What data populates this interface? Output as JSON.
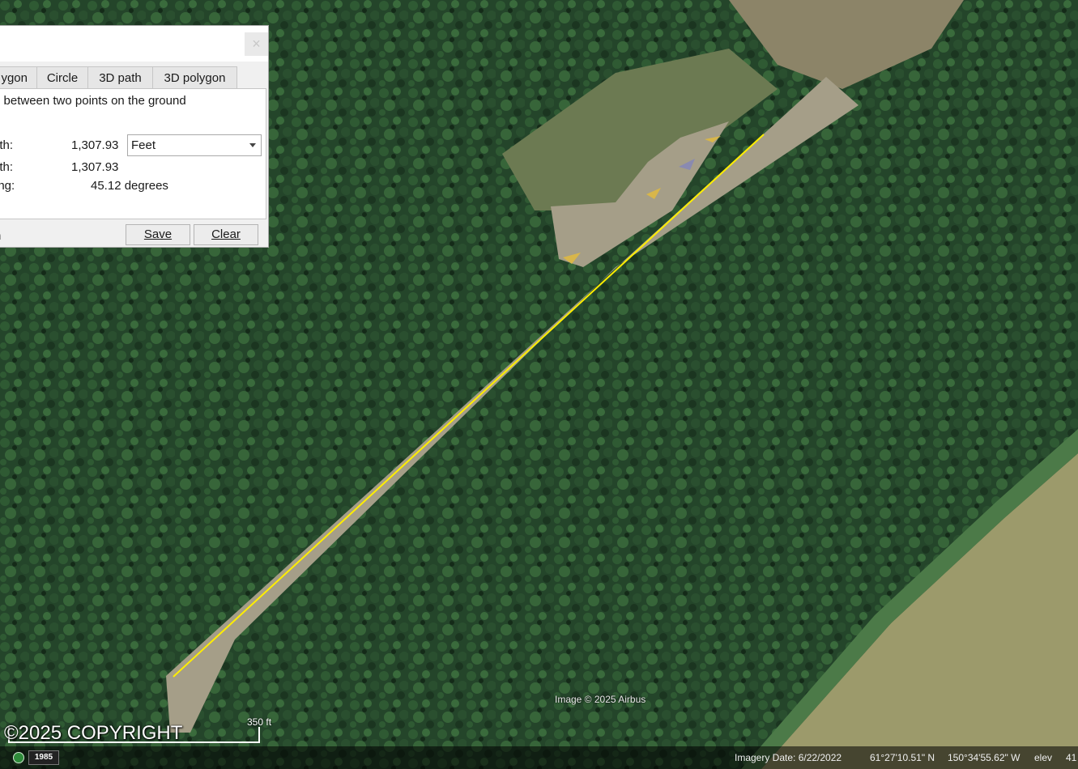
{
  "ruler_dialog": {
    "close_glyph": "×",
    "tabs": [
      {
        "label": "ygon"
      },
      {
        "label": "Circle"
      },
      {
        "label": "3D path"
      },
      {
        "label": "3D polygon"
      }
    ],
    "description": "e between two points on the ground",
    "map_length_label": "gth:",
    "map_length_value": "1,307.93",
    "units_selected": "Feet",
    "ground_length_label": "gth:",
    "ground_length_value": "1,307.93",
    "heading_label": "ing:",
    "heading_value": "45.12 degrees",
    "mouse_nav_label": "n",
    "save_label": "Save",
    "clear_label": "Clear"
  },
  "map": {
    "image_credit": "Image © 2025 Airbus",
    "copyright": "©2025 COPYRIGHT",
    "scale_label": "350 ft",
    "measure_line_color": "#ffee00"
  },
  "status_bar": {
    "history_year": "1985",
    "imagery_date": "Imagery Date: 6/22/2022",
    "latitude": "61°27'10.51\" N",
    "longitude": "150°34'55.62\" W",
    "elev_label": "elev",
    "elev_value": "41"
  },
  "icons": {
    "close": "close-icon",
    "units_dropdown": "chevron-down-icon",
    "historical_imagery": "clock-icon"
  }
}
